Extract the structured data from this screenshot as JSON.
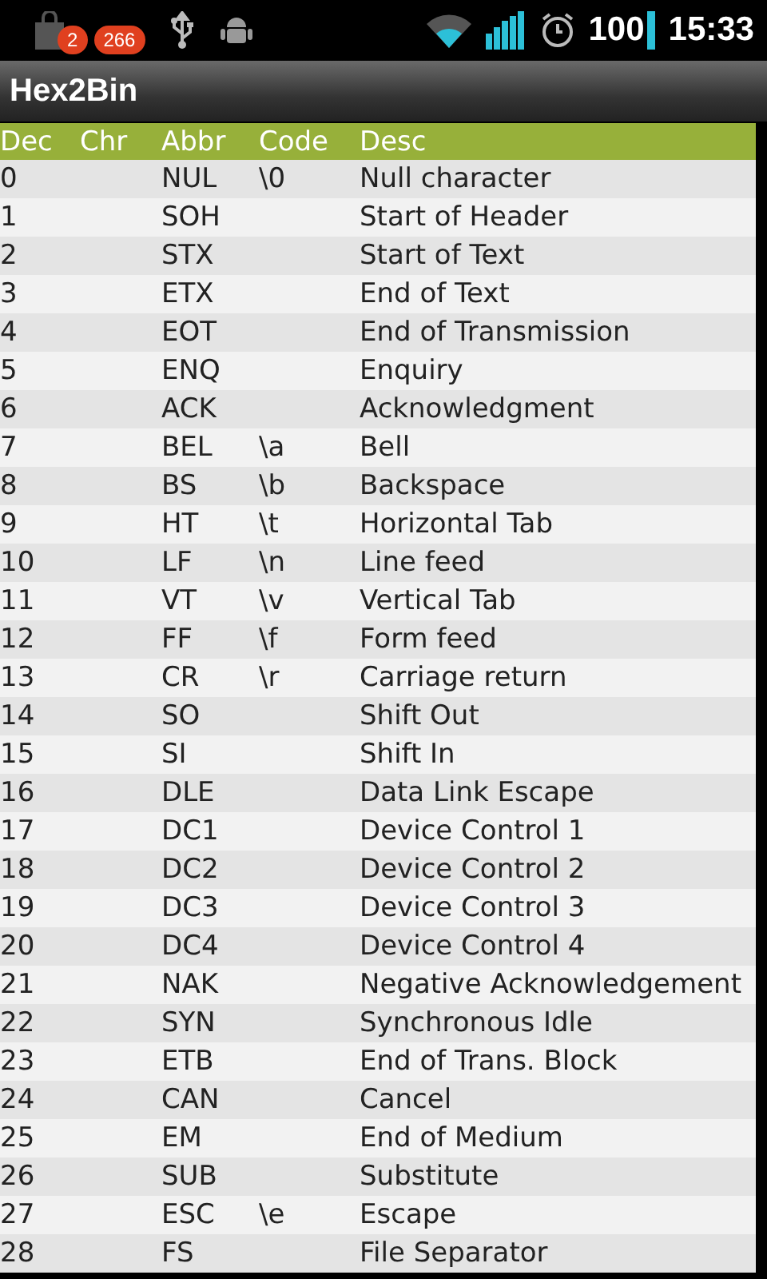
{
  "status_bar": {
    "badges": [
      "2",
      "266"
    ],
    "battery": "100",
    "time": "15:33"
  },
  "title": "Hex2Bin",
  "table": {
    "columns": [
      "Dec",
      "Chr",
      "Abbr",
      "Code",
      "Desc"
    ],
    "rows": [
      [
        "0",
        "",
        "NUL",
        "\\0",
        "Null character"
      ],
      [
        "1",
        "",
        "SOH",
        "",
        "Start of Header"
      ],
      [
        "2",
        "",
        "STX",
        "",
        "Start of Text"
      ],
      [
        "3",
        "",
        "ETX",
        "",
        "End of Text"
      ],
      [
        "4",
        "",
        "EOT",
        "",
        "End of Transmission"
      ],
      [
        "5",
        "",
        "ENQ",
        "",
        "Enquiry"
      ],
      [
        "6",
        "",
        "ACK",
        "",
        "Acknowledgment"
      ],
      [
        "7",
        "",
        "BEL",
        "\\a",
        "Bell"
      ],
      [
        "8",
        "",
        "BS",
        "\\b",
        "Backspace"
      ],
      [
        "9",
        "",
        "HT",
        "\\t",
        "Horizontal Tab"
      ],
      [
        "10",
        "",
        "LF",
        "\\n",
        "Line feed"
      ],
      [
        "11",
        "",
        "VT",
        "\\v",
        "Vertical Tab"
      ],
      [
        "12",
        "",
        "FF",
        "\\f",
        "Form feed"
      ],
      [
        "13",
        "",
        "CR",
        "\\r",
        "Carriage return"
      ],
      [
        "14",
        "",
        "SO",
        "",
        "Shift Out"
      ],
      [
        "15",
        "",
        "SI",
        "",
        "Shift In"
      ],
      [
        "16",
        "",
        "DLE",
        "",
        "Data Link Escape"
      ],
      [
        "17",
        "",
        "DC1",
        "",
        "Device Control 1"
      ],
      [
        "18",
        "",
        "DC2",
        "",
        "Device Control 2"
      ],
      [
        "19",
        "",
        "DC3",
        "",
        "Device Control 3"
      ],
      [
        "20",
        "",
        "DC4",
        "",
        "Device Control 4"
      ],
      [
        "21",
        "",
        "NAK",
        "",
        "Negative Acknowledgement"
      ],
      [
        "22",
        "",
        "SYN",
        "",
        "Synchronous Idle"
      ],
      [
        "23",
        "",
        "ETB",
        "",
        "End of Trans. Block"
      ],
      [
        "24",
        "",
        "CAN",
        "",
        "Cancel"
      ],
      [
        "25",
        "",
        "EM",
        "",
        "End of Medium"
      ],
      [
        "26",
        "",
        "SUB",
        "",
        "Substitute"
      ],
      [
        "27",
        "",
        "ESC",
        "\\e",
        "Escape"
      ],
      [
        "28",
        "",
        "FS",
        "",
        "File Separator"
      ]
    ]
  }
}
